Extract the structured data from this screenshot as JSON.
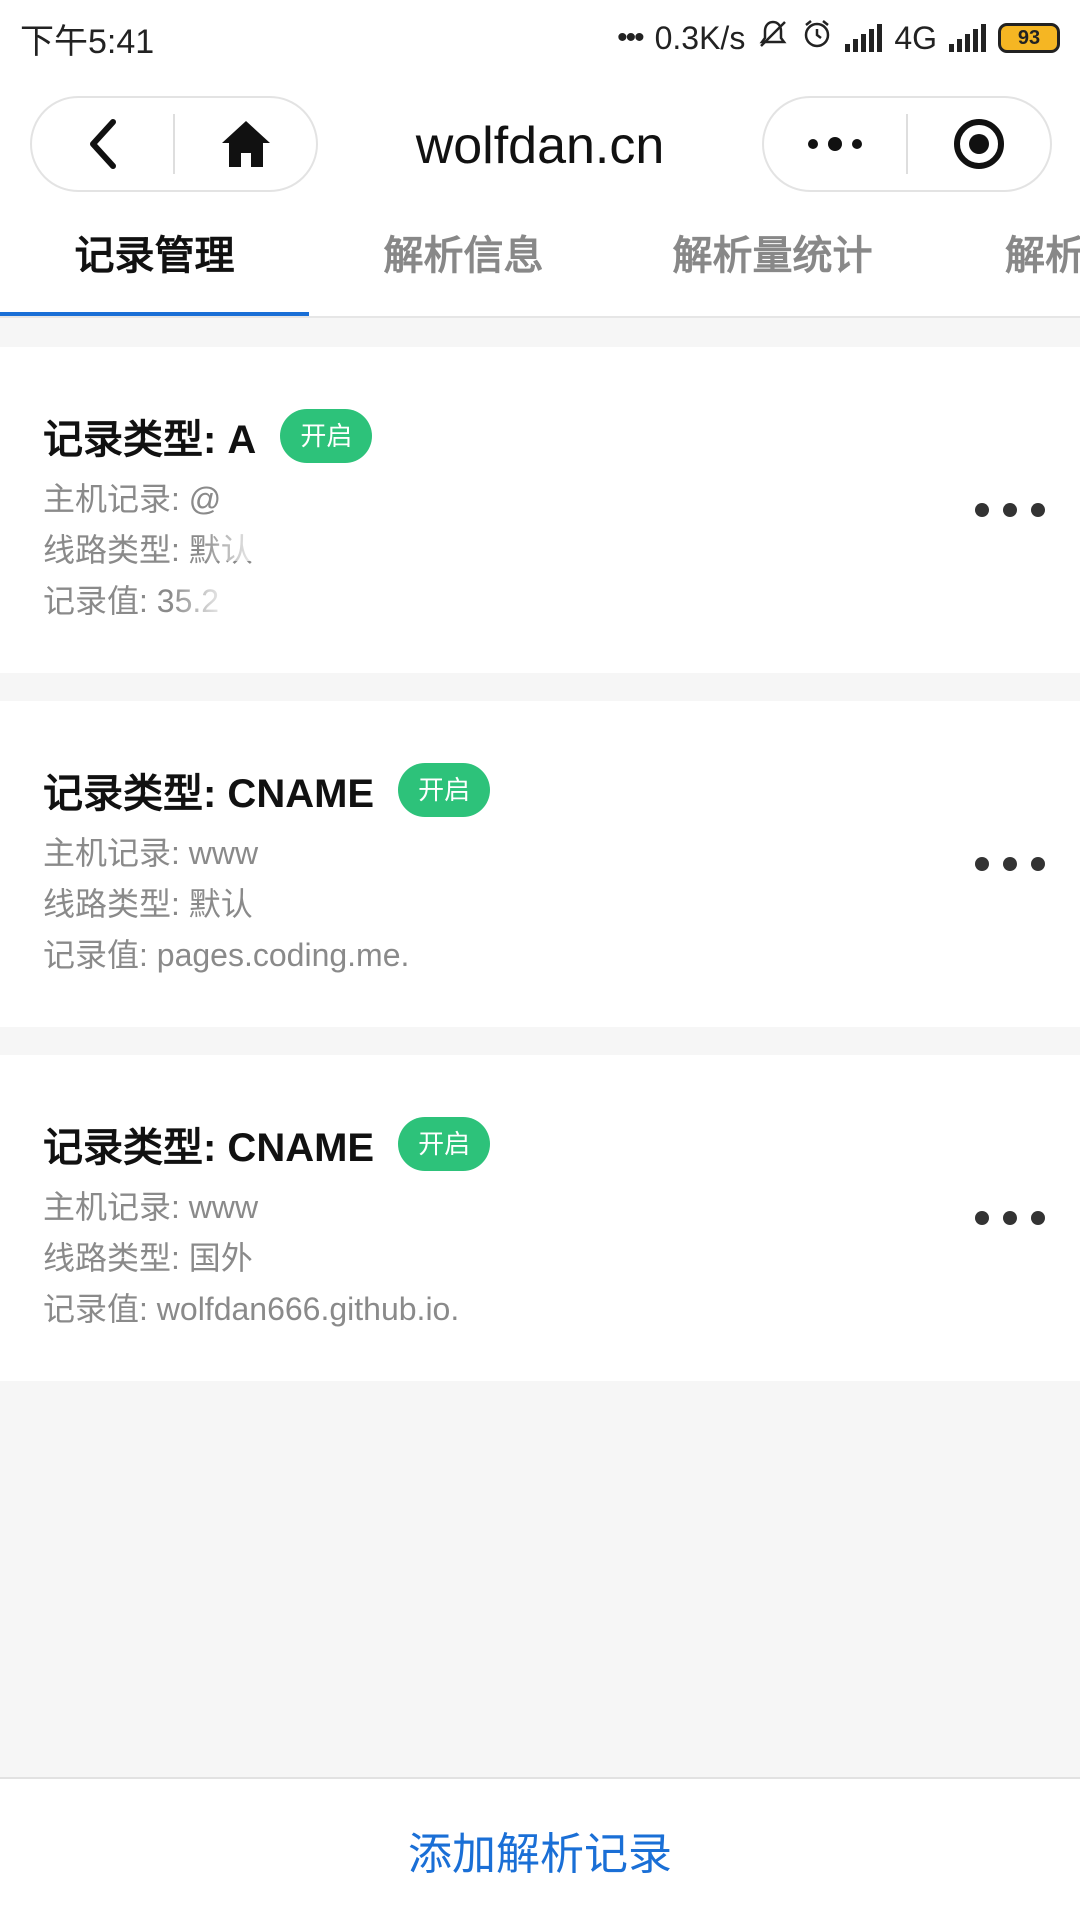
{
  "status_bar": {
    "time": "下午5:41",
    "network_speed": "0.3K/s",
    "network_type": "4G",
    "battery": "93",
    "icons": [
      "mute-icon",
      "alarm-icon",
      "signal-icon",
      "battery-icon"
    ]
  },
  "nav": {
    "title": "wolfdan.cn",
    "back_icon": "chevron-left-icon",
    "home_icon": "home-icon",
    "more_icon": "more-dots-icon",
    "close_icon": "target-close-icon"
  },
  "tabs": [
    {
      "label": "记录管理",
      "active": true
    },
    {
      "label": "解析信息",
      "active": false
    },
    {
      "label": "解析量统计",
      "active": false
    },
    {
      "label": "解析",
      "active": false
    }
  ],
  "records": [
    {
      "type_line": "记录类型: A",
      "status": "开启",
      "host": "主机记录: @",
      "line": "线路类型: 默认",
      "value": "记录值: 35.2"
    },
    {
      "type_line": "记录类型: CNAME",
      "status": "开启",
      "host": "主机记录: www",
      "line": "线路类型: 默认",
      "value": "记录值: pages.coding.me."
    },
    {
      "type_line": "记录类型: CNAME",
      "status": "开启",
      "host": "主机记录: www",
      "line": "线路类型: 国外",
      "value": "记录值: wolfdan666.github.io."
    }
  ],
  "footer": {
    "add_label": "添加解析记录"
  },
  "colors": {
    "accent": "#1a6fd6",
    "status_on": "#2dc27a",
    "battery": "#f5b623"
  }
}
